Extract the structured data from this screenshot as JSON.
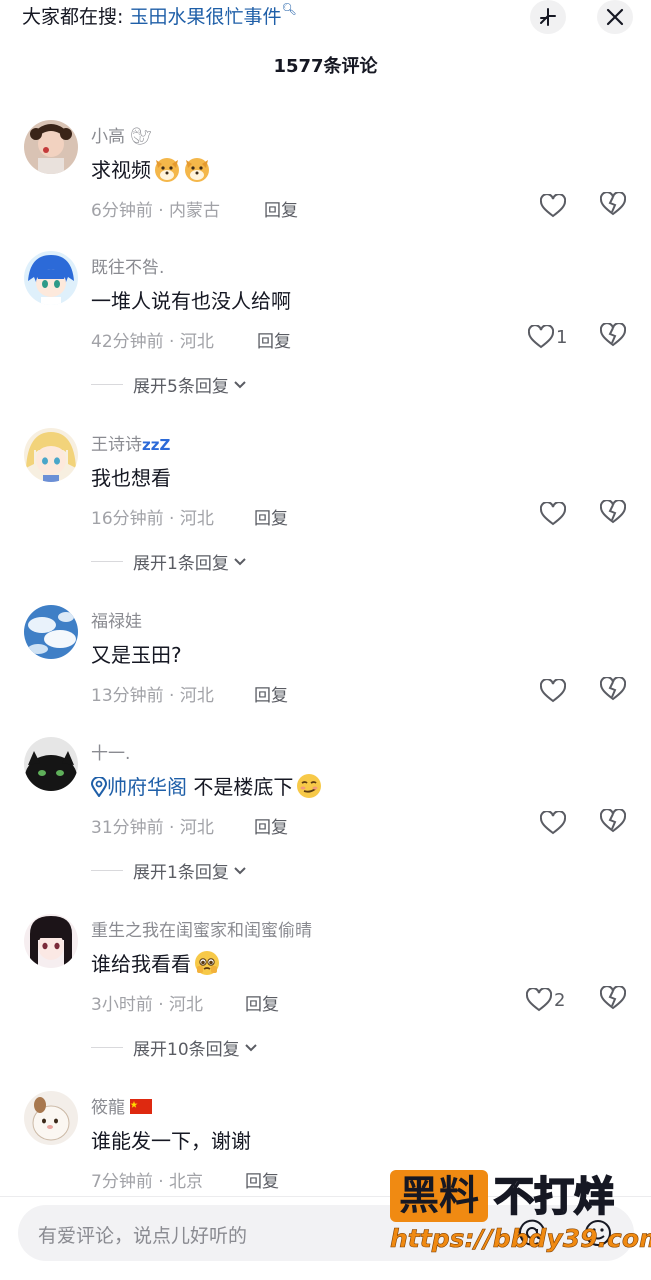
{
  "header": {
    "search_prefix": "大家都在搜:",
    "search_keyword": "玉田水果很忙事件",
    "comment_count": "1577条评论"
  },
  "comments": [
    {
      "username": "小高",
      "text": "求视频",
      "time_location": "6分钟前 · 内蒙古",
      "reply": "回复",
      "likes": ""
    },
    {
      "username": "既往不咎.",
      "text": "一堆人说有也没人给啊",
      "time_location": "42分钟前 · 河北",
      "reply": "回复",
      "likes": "1",
      "expand": "展开5条回复"
    },
    {
      "username": "王诗诗",
      "username_suffix": "zzZ",
      "text": "我也想看",
      "time_location": "16分钟前 · 河北",
      "reply": "回复",
      "likes": "",
      "expand": "展开1条回复"
    },
    {
      "username": "福禄娃",
      "text": "又是玉田?",
      "time_location": "13分钟前 · 河北",
      "reply": "回复",
      "likes": ""
    },
    {
      "username": "十一.",
      "location_tag": "帅府华阁",
      "text": "不是楼底下",
      "time_location": "31分钟前 · 河北",
      "reply": "回复",
      "likes": "",
      "expand": "展开1条回复"
    },
    {
      "username": "重生之我在闺蜜家和闺蜜偷晴",
      "text": "谁给我看看",
      "time_location": "3小时前 · 河北",
      "reply": "回复",
      "likes": "2",
      "expand": "展开10条回复"
    },
    {
      "username": "筱龍",
      "text": "谁能发一下，谢谢",
      "time_location": "7分钟前 · 北京",
      "reply": "回复",
      "likes": ""
    }
  ],
  "input": {
    "placeholder": "有爱评论，说点儿好听的"
  },
  "watermark": {
    "badge": "黑料",
    "text": "不打烊",
    "url": "https://bbdy39.com"
  },
  "colors": {
    "link_blue": "#1f5fa8",
    "muted_text": "#a1a2a7",
    "watermark_orange": "#f08a12"
  }
}
